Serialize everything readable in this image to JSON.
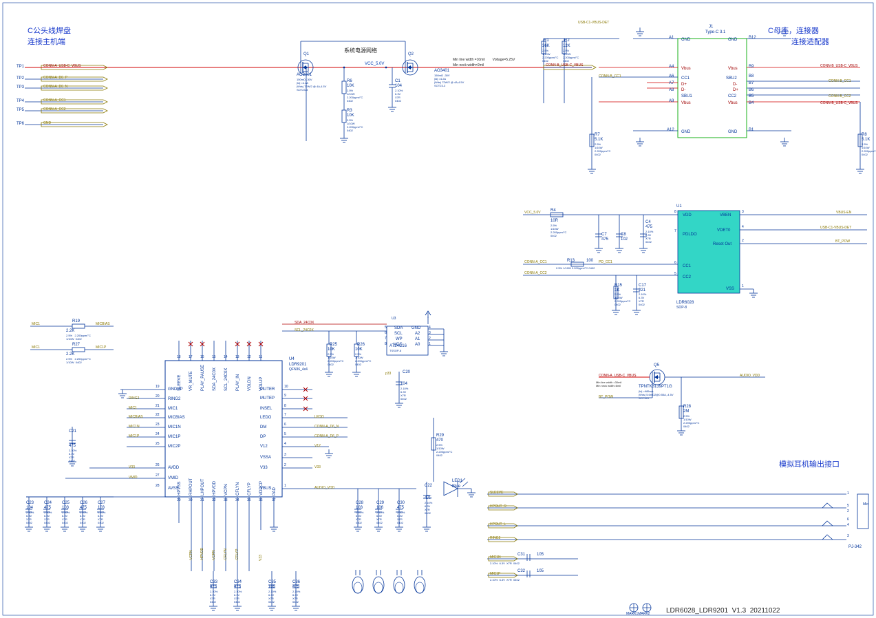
{
  "footer": {
    "marks": "MARK1MARK2",
    "title": "LDR6028_LDR9201  V1.3  20211022"
  },
  "headers": {
    "c_plug_title": "C公头线焊盘",
    "c_plug_sub": "连接主机端",
    "c_recept_title": "C母座，连接器",
    "c_recept_sub": "连接适配器",
    "sys_pwr": "系统电源网络",
    "audio_out": "模拟耳机输出接口"
  },
  "testpoints": [
    "TP1",
    "TP2",
    "TP3",
    "TP4",
    "TP5",
    "TP6"
  ],
  "tp_nets": [
    "CONN-A_USB-C_VBUS",
    "CONN-A_D6_P",
    "CONN-A_D6_N",
    "CONN-A_CC1",
    "CONN-A_CC2",
    "GND"
  ],
  "lower_tp_nets": [
    "CONN-A_CC2",
    "CONN-A_CC1"
  ],
  "vbus_note": {
    "l1": "Min line width =10mil        Voltage=5.25V",
    "l2": "Min neck width=2mil"
  },
  "vcc_label": "VCC_5.0V",
  "q1": {
    "ref": "Q1",
    "pn": "AO3401",
    "spec": "150mΩ -30V\n|Id| =4.2A\n|Wds| 72W/2 @ 4A,4.5V\nSOT23-3"
  },
  "q2": {
    "ref": "Q2",
    "pn": "AO3401",
    "spec": "150mΩ -30V\n|Id| =4.2A\n|Wds| 72W/2 @ 4A,4.5V\nSOT23-3"
  },
  "q5": {
    "ref": "Q5",
    "pn": "TPNTK3139PT1G",
    "spec": "|Id| =985mA\n|Wds| 5.6mΩ2@0.55A,-4.5V\nSOT323"
  },
  "r_top": {
    "R1": {
      "val": "36K",
      "tol": "2.5%\n1/10W\n2.200ppm/°C\n0402"
    },
    "R2": {
      "val": "12K",
      "tol": "2.5%\n1/10W\n2.200ppm/°C\n0402"
    },
    "R6": {
      "val": "10K",
      "tol": "2.5%\n1/10W\n2.200ppm/°C\n0402"
    },
    "R3": {
      "val": "10K",
      "tol": "2.5%\n1/10W\n2.200ppm/°C\n0402"
    },
    "R7": {
      "val": "5.1K",
      "tol": "2.5%\n1/10W\n2.200ppm/°C\n0402"
    },
    "R8": {
      "val": "5.1K",
      "tol": "2.5%\n1/10W\n2.200ppm/°C\n0402"
    }
  },
  "c1": {
    "ref": "C1",
    "val": "104",
    "spec": "2.10%\n6.3V\nX7R\n0402"
  },
  "j1": {
    "ref": "J1",
    "pn": "Type-C 3.1",
    "pins_l": [
      "A1",
      "A4",
      "A6",
      "A7",
      "A8",
      "A9",
      "A12"
    ],
    "sig_l": [
      "GND",
      "Vbus",
      "CC1",
      "D+",
      "D-",
      "SBU1",
      "Vbus",
      "GND"
    ],
    "pins_r": [
      "B12",
      "B9",
      "B8",
      "B7",
      "B6",
      "B5",
      "B4",
      "B1"
    ],
    "sig_r": [
      "GND",
      "Vbus",
      "SBU2",
      "D-",
      "D+",
      "CC2",
      "Vbus",
      "GND"
    ]
  },
  "nets_right": [
    "USB-C1-VBUS-DET",
    "CONN-B_USB-C_VBUS",
    "CONN-B_USB-C_VBUS",
    "CONN-B_CC1",
    "CONN-B_CC2",
    "CONN-B_USB-C_VBUS"
  ],
  "u1": {
    "ref": "U1",
    "pn": "LDR6028",
    "foot": "SOP-8",
    "pins": {
      "1": "VSS",
      "2": "Reset Out",
      "3": "VBEN",
      "4": "VDET0",
      "5": "CC2",
      "6": "CC1",
      "7": "PDLDO",
      "8": "VDD"
    }
  },
  "u1_nets": {
    "left": [
      "VCC_5.0V",
      "CONN-A_CC1",
      "CONN-A_CC2"
    ],
    "right": [
      "VBUS-EN",
      "USB-C1-VBUS-DET",
      "BT_POW"
    ]
  },
  "u1_rc": {
    "R4": {
      "val": "10R",
      "tol": "2.5%\n1/10W\n2.200ppm/°C\n0402"
    },
    "C7": {
      "val": "475",
      "spec": "2.10%\n6.3V\nX7R\n0402"
    },
    "C8": {
      "val": "102"
    },
    "C4": {
      "val": "475",
      "spec": "2.10%\n6.3V\nX7R\n0402"
    },
    "R13": {
      "val": "100",
      "tol": "2.5% 1/10W 2.200ppm/°C 0402"
    },
    "R15": {
      "val": "1K",
      "tol": "2.5%\n1/10W\n2.200ppm/°C\n0402"
    },
    "C17": {
      "val": "221",
      "spec": "2.10%\n6.3V\nX7R\n0402"
    }
  },
  "pd_cc1": "PD_CC1",
  "r19": {
    "ref": "R19",
    "val": "2.2K",
    "tol": "2.5%   2.200ppm/°C\n1/10W  0402"
  },
  "r27": {
    "ref": "R27",
    "val": "2.2K",
    "tol": "2.5%   2.200ppm/°C\n1/10W  0402"
  },
  "mic_nets": {
    "a": "MIC1",
    "b": "MICBIAS",
    "c": "MIC1",
    "d": "MIC1P"
  },
  "u4": {
    "ref": "U4",
    "pn": "LDR9201",
    "pkg": "QFN36_4x4",
    "left": [
      "GNDHP",
      "RING2",
      "MIC1",
      "MICBIAS",
      "MIC1N",
      "MIC1P",
      "MIC2P",
      "AVDD",
      "VMID",
      "AVSS"
    ],
    "right": [
      "MUTER",
      "MUTEP",
      "INSEL",
      "LEDO",
      "DM",
      "DP",
      "V12",
      "VSSA",
      "V33",
      "VBUS"
    ],
    "top": [
      "SLEEVE",
      "VR_MUTE",
      "PLAY_PAUSE",
      "SDA_24C0X",
      "SCL_24C0X",
      "PLAY_IN",
      "VOLDN",
      "VOLUP"
    ],
    "bot": [
      "HPVSS",
      "RHPOUT",
      "LHPOUT",
      "HPVDD",
      "VCPN",
      "CFLYN",
      "CFLYP",
      "VDDCP",
      "PAD"
    ],
    "left_pins": [
      "19",
      "20",
      "21",
      "22",
      "23",
      "24",
      "25",
      "26",
      "27",
      "28"
    ],
    "right_pins": [
      "10",
      "9",
      "8",
      "7",
      "6",
      "5",
      "4",
      "3",
      "2",
      "1"
    ],
    "top_pins": [
      "18",
      "17",
      "16",
      "15",
      "14",
      "13",
      "12",
      "11"
    ],
    "bot_pins": [
      "29",
      "30",
      "31",
      "32",
      "33",
      "34",
      "35",
      "36",
      "37"
    ]
  },
  "u4_left_nets": [
    "",
    "RING2",
    "MIC1",
    "MICBIAS",
    "MIC1N",
    "MIC1P",
    "",
    "V33",
    "VMID",
    ""
  ],
  "u4_right_nets": [
    "",
    "",
    "",
    "LEDO",
    "CONN-A_D6_N",
    "CONN-A_D6_P",
    "V12",
    "",
    "V33",
    "AUDIO_VDD"
  ],
  "sda_net": "SDA_24C0X",
  "scl_net": "SCL_24C0X",
  "r25": {
    "ref": "R25",
    "val": "10K",
    "tol": "2.5%\n1/10W\n2.200ppm/°C\n0402"
  },
  "r26": {
    "ref": "R26",
    "val": "10K",
    "tol": "2.5%\n1/10W\n2.200ppm/°C\n0402"
  },
  "u3": {
    "ref": "U3",
    "pn": "AT24C16",
    "pkg": "TSSOP-8",
    "pins": {
      "1": "A0",
      "2": "A1",
      "3": "A2",
      "4": "GND",
      "5": "SDA",
      "6": "SCL",
      "7": "WP",
      "8": "VCC"
    }
  },
  "c20": {
    "ref": "C20",
    "val": "104",
    "spec": "2.10%\n6.3V\nX7R\n0402"
  },
  "c21": {
    "ref": "C21",
    "val": "475",
    "spec": "2.10%\n6.3V\nX7R\n0402"
  },
  "caps_row": [
    {
      "ref": "C23",
      "val": "104"
    },
    {
      "ref": "C24",
      "val": "475"
    },
    {
      "ref": "C25",
      "val": "103"
    },
    {
      "ref": "C26",
      "val": "475"
    },
    {
      "ref": "C27",
      "val": "103"
    }
  ],
  "cap_spec": "2.10%\n6.3V\nX7R\n0402",
  "cap_spec2": "2.5V",
  "c28": {
    "ref": "C28",
    "val": "103"
  },
  "c29": {
    "ref": "C29",
    "val": "106"
  },
  "c30": {
    "ref": "C30",
    "val": "475"
  },
  "c33": {
    "ref": "C33",
    "val": "475"
  },
  "c34": {
    "ref": "C34",
    "val": "475"
  },
  "c35": {
    "ref": "C35",
    "val": "105"
  },
  "c36": {
    "ref": "C36",
    "val": "475"
  },
  "r29": {
    "ref": "R29",
    "val": "470",
    "tol": "2.5%\n1/10W\n2.200ppm/°C\n0402"
  },
  "c22": {
    "ref": "C22",
    "val": "475",
    "spec": "2.10%\n6.3V\nX7R\n0402"
  },
  "led": {
    "ref": "LED1",
    "color": "Blue"
  },
  "q5_nets": {
    "in": "CONN-A_USB-C_VBUS",
    "out": "AUDIO_VDD",
    "gate": "BT_POW"
  },
  "q5_note": "Min line width =30mil\nMin neck width=6mil",
  "r28": {
    "ref": "R28",
    "val": "2M",
    "tol": "2.5%\n1/10W\n2.200ppm/°C\n0402"
  },
  "jack": {
    "ref": "PJ-342",
    "nets": [
      "SLEEVE",
      "HPOUT_R",
      "HPOUT_L",
      "RING2",
      "MIC1N",
      "MIC1P"
    ],
    "mic_label": "Mic"
  },
  "c31": {
    "ref": "C31",
    "val": "105",
    "tol": "2.10%  6.3V  X7R  0402"
  },
  "c32": {
    "ref": "C32",
    "val": "105",
    "tol": "2.10%  6.3V  X7R  0402"
  },
  "bot_bus_nets": [
    "-VCPN",
    "-HPVDD",
    "-VCPN",
    "-CFLYN",
    "-CFLYP",
    "V33"
  ],
  "p33": "p33"
}
